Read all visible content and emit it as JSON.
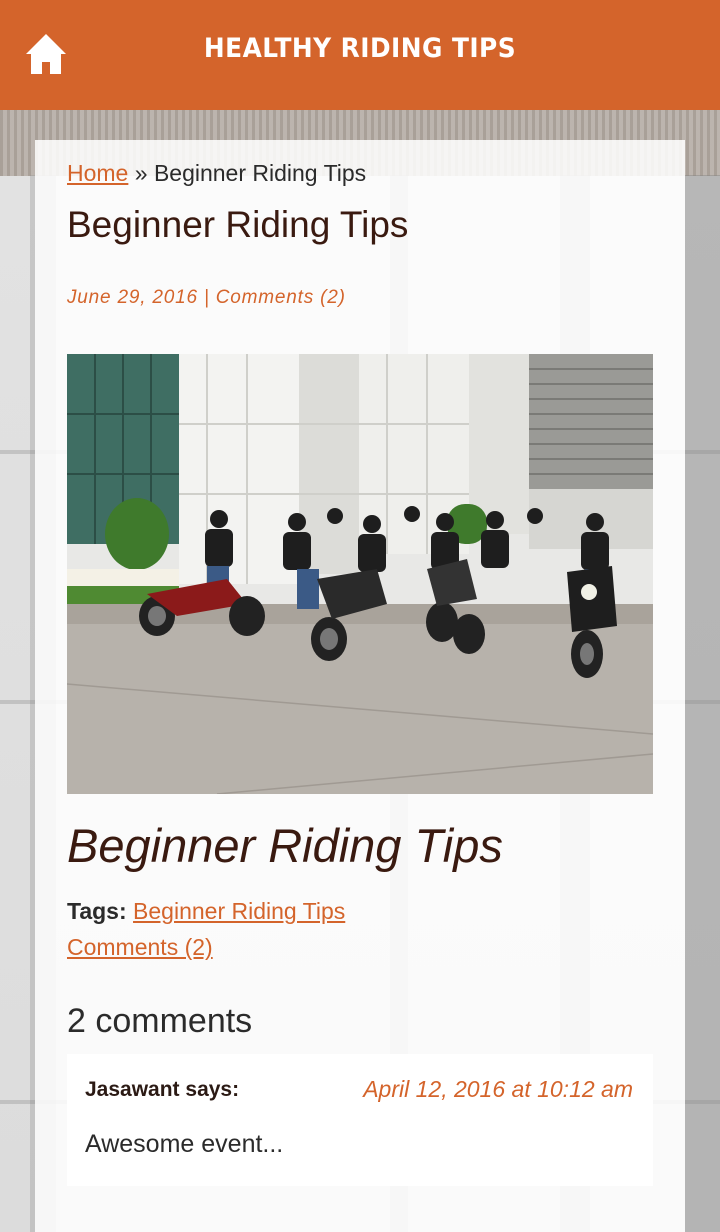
{
  "header": {
    "title": "HEALTHY RIDING TIPS",
    "home_icon": "home-icon",
    "background_color": "#d4642b"
  },
  "breadcrumb": {
    "home_label": "Home",
    "separator": "»",
    "current": "Beginner Riding Tips"
  },
  "post": {
    "heading": "Beginner Riding Tips",
    "date": "June 29, 2016",
    "meta_separator": "|",
    "comments_meta": "Comments (2)",
    "title": "Beginner Riding Tips",
    "tags_label": "Tags:",
    "tag": "Beginner Riding Tips",
    "comments_link": "Comments (2)"
  },
  "comments": {
    "count_label": "2 comments",
    "items": [
      {
        "author": "Jasawant says:",
        "date": "April 12, 2016 at 10:12 am",
        "text": "Awesome event..."
      }
    ]
  },
  "accent_color": "#d4642b"
}
